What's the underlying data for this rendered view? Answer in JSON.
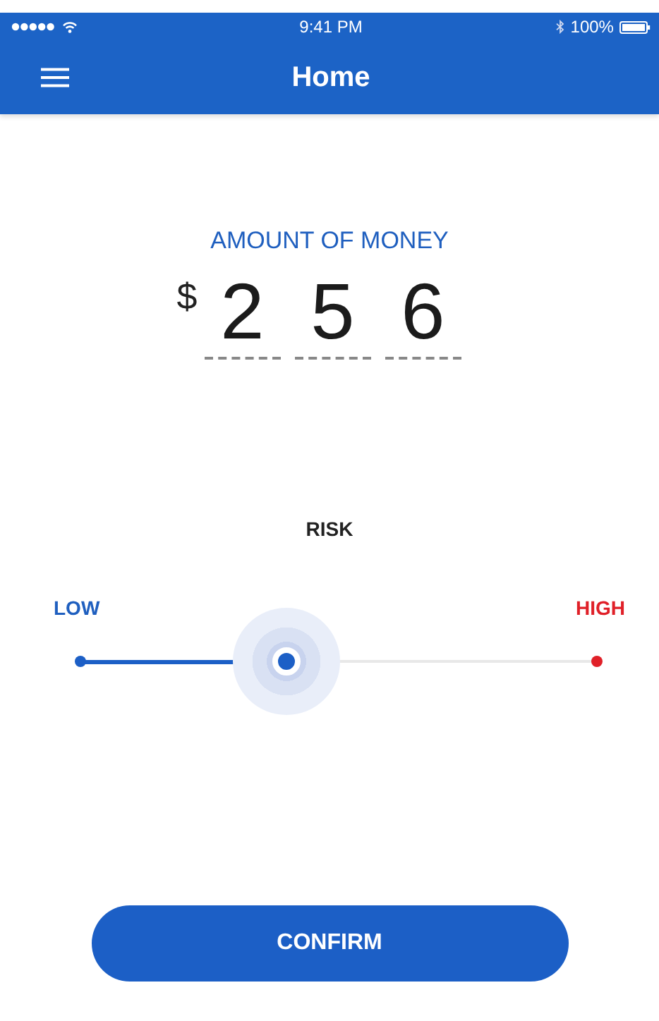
{
  "status_bar": {
    "time": "9:41 PM",
    "battery": "100%"
  },
  "nav_bar": {
    "title": "Home"
  },
  "amount": {
    "label": "AMOUNT OF MONEY",
    "currency": "$",
    "digits": [
      "2",
      "5",
      "6"
    ]
  },
  "risk": {
    "label": "RISK",
    "min_label": "LOW",
    "max_label": "HIGH",
    "level": 0.4
  },
  "confirm_button": "CONFIRM"
}
